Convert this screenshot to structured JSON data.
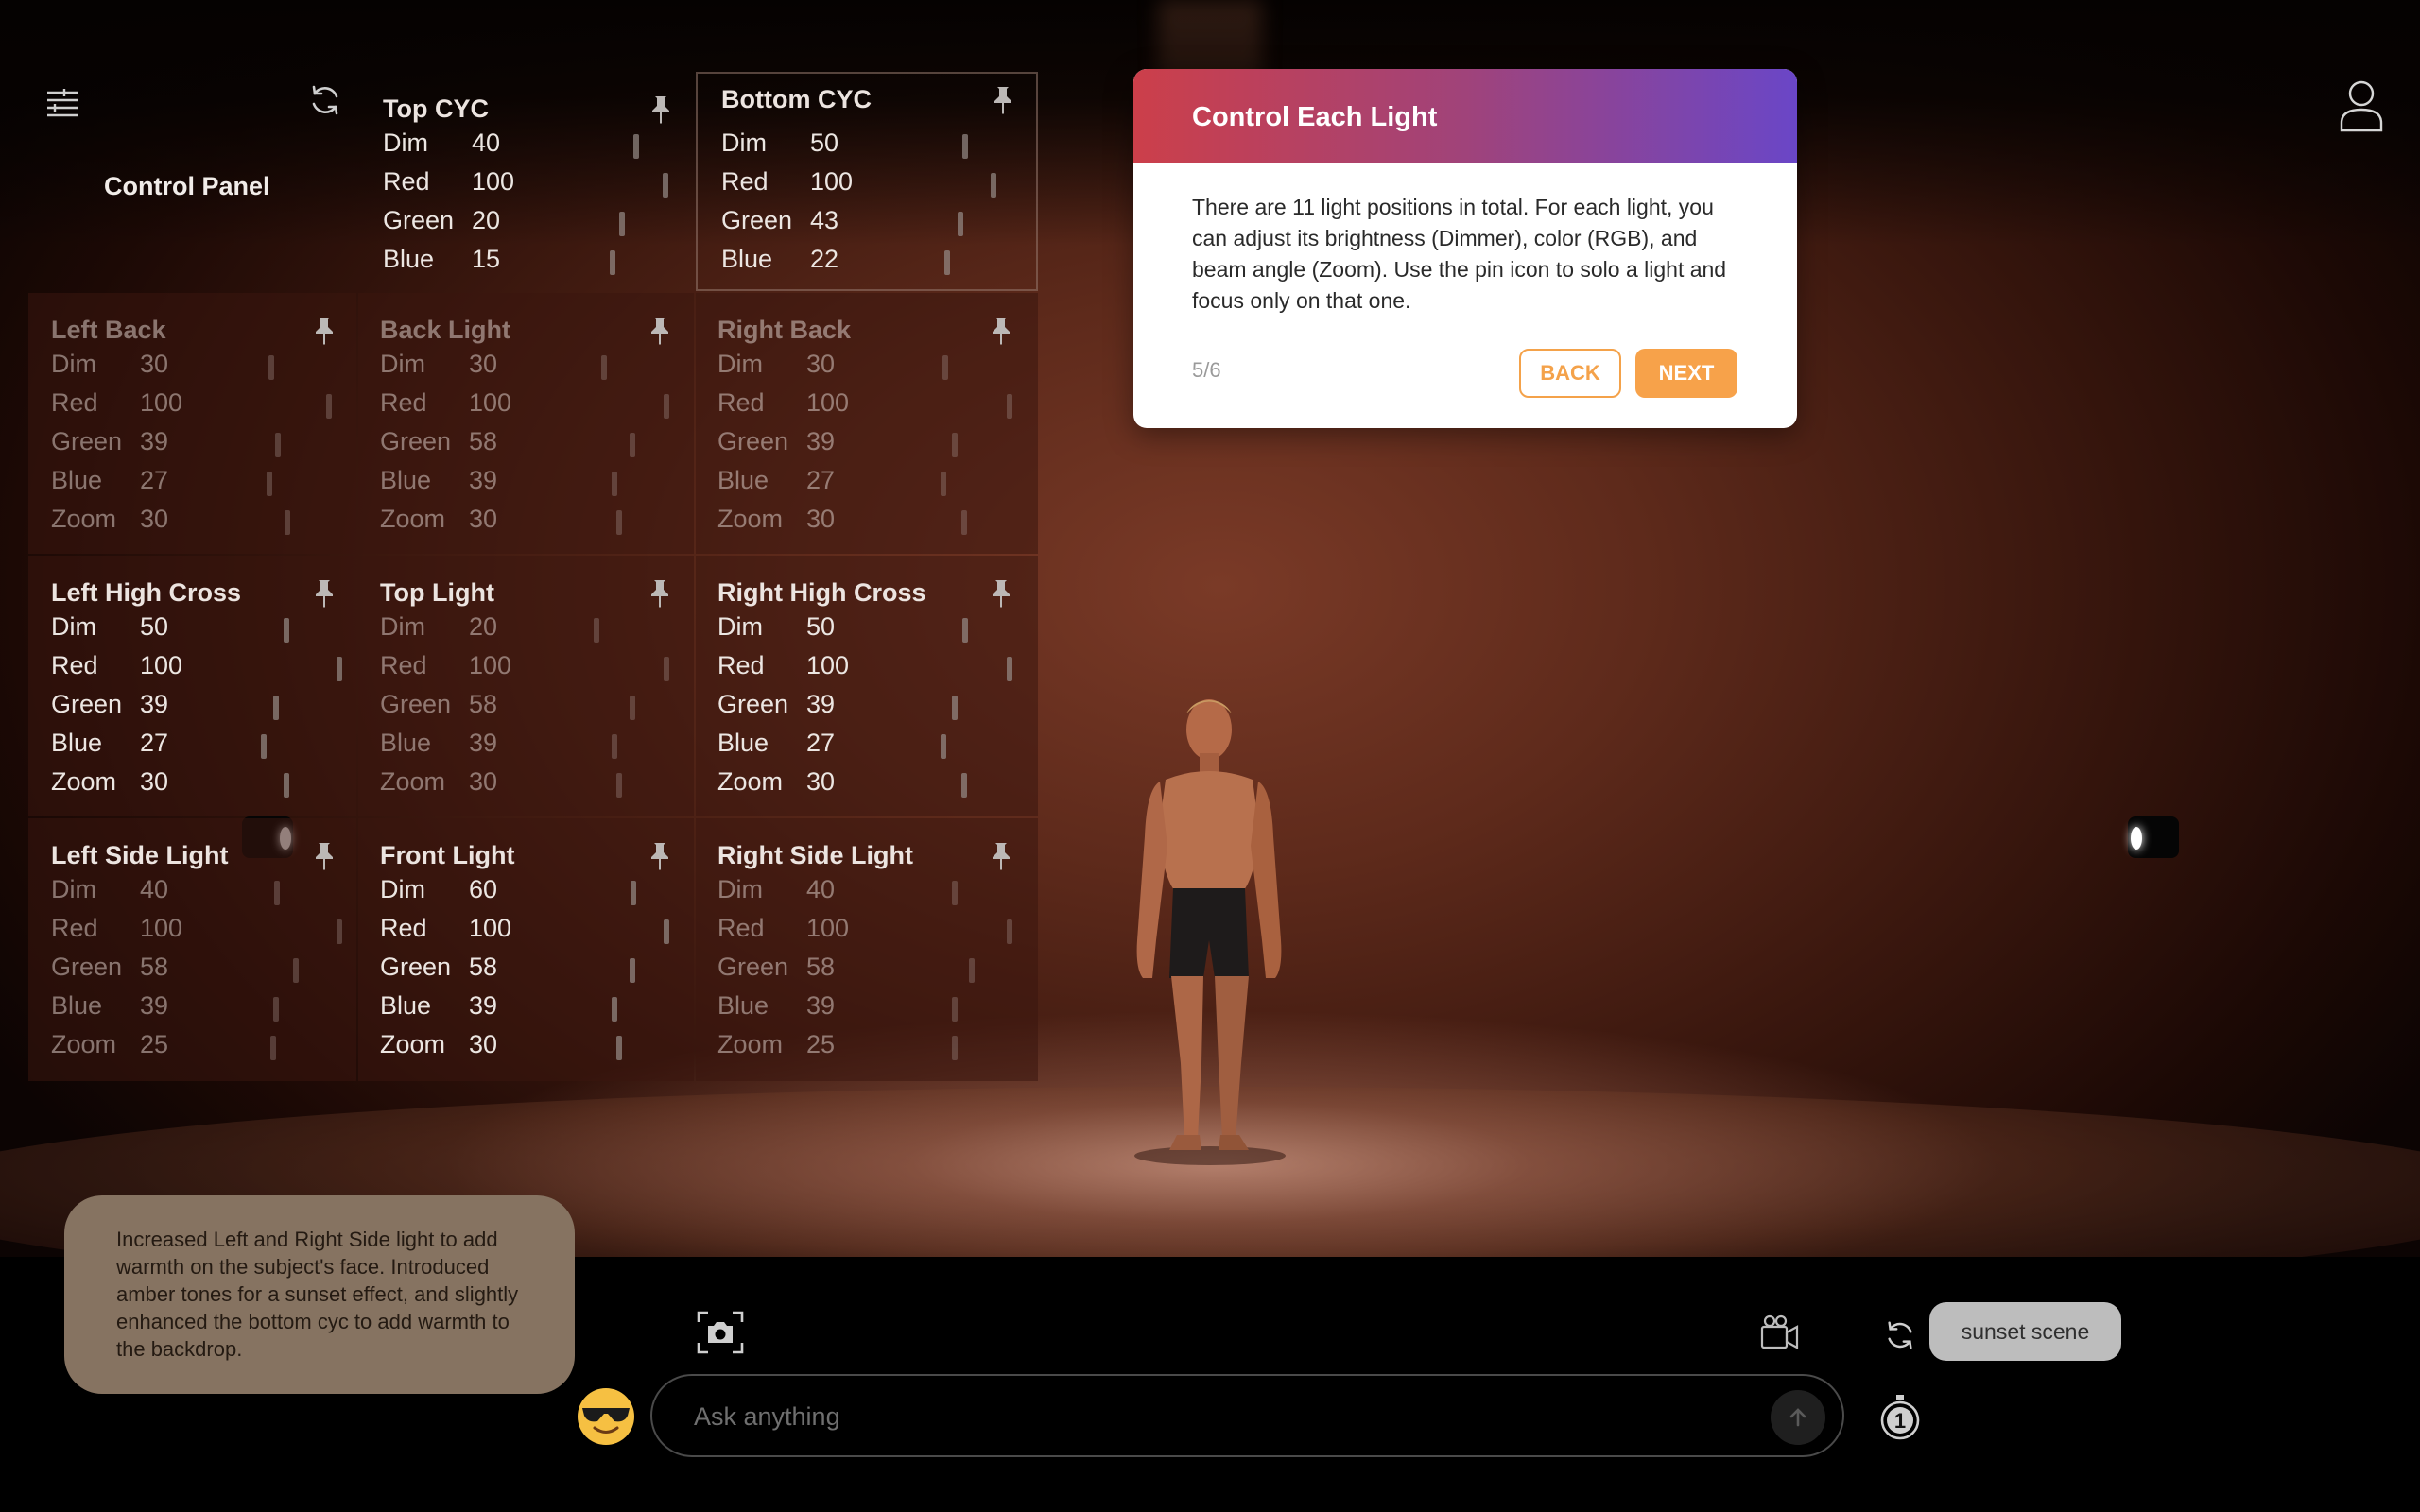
{
  "app": {
    "title": "Control Panel"
  },
  "panels": {
    "top_cyc": {
      "title": "Top CYC",
      "rows": [
        {
          "label": "Dim",
          "value": "40"
        },
        {
          "label": "Red",
          "value": "100"
        },
        {
          "label": "Green",
          "value": "20"
        },
        {
          "label": "Blue",
          "value": "15"
        }
      ]
    },
    "bottom_cyc": {
      "title": "Bottom CYC",
      "rows": [
        {
          "label": "Dim",
          "value": "50"
        },
        {
          "label": "Red",
          "value": "100"
        },
        {
          "label": "Green",
          "value": "43"
        },
        {
          "label": "Blue",
          "value": "22"
        }
      ]
    },
    "left_back": {
      "title": "Left Back",
      "rows": [
        {
          "label": "Dim",
          "value": "30"
        },
        {
          "label": "Red",
          "value": "100"
        },
        {
          "label": "Green",
          "value": "39"
        },
        {
          "label": "Blue",
          "value": "27"
        },
        {
          "label": "Zoom",
          "value": "30"
        }
      ]
    },
    "back_light": {
      "title": "Back Light",
      "rows": [
        {
          "label": "Dim",
          "value": "30"
        },
        {
          "label": "Red",
          "value": "100"
        },
        {
          "label": "Green",
          "value": "58"
        },
        {
          "label": "Blue",
          "value": "39"
        },
        {
          "label": "Zoom",
          "value": "30"
        }
      ]
    },
    "right_back": {
      "title": "Right Back",
      "rows": [
        {
          "label": "Dim",
          "value": "30"
        },
        {
          "label": "Red",
          "value": "100"
        },
        {
          "label": "Green",
          "value": "39"
        },
        {
          "label": "Blue",
          "value": "27"
        },
        {
          "label": "Zoom",
          "value": "30"
        }
      ]
    },
    "left_high_cross": {
      "title": "Left High Cross",
      "rows": [
        {
          "label": "Dim",
          "value": "50"
        },
        {
          "label": "Red",
          "value": "100"
        },
        {
          "label": "Green",
          "value": "39"
        },
        {
          "label": "Blue",
          "value": "27"
        },
        {
          "label": "Zoom",
          "value": "30"
        }
      ]
    },
    "top_light": {
      "title": "Top Light",
      "rows": [
        {
          "label": "Dim",
          "value": "20"
        },
        {
          "label": "Red",
          "value": "100"
        },
        {
          "label": "Green",
          "value": "58"
        },
        {
          "label": "Blue",
          "value": "39"
        },
        {
          "label": "Zoom",
          "value": "30"
        }
      ]
    },
    "right_high_cross": {
      "title": "Right High Cross",
      "rows": [
        {
          "label": "Dim",
          "value": "50"
        },
        {
          "label": "Red",
          "value": "100"
        },
        {
          "label": "Green",
          "value": "39"
        },
        {
          "label": "Blue",
          "value": "27"
        },
        {
          "label": "Zoom",
          "value": "30"
        }
      ]
    },
    "left_side_light": {
      "title": "Left Side Light",
      "rows": [
        {
          "label": "Dim",
          "value": "40"
        },
        {
          "label": "Red",
          "value": "100"
        },
        {
          "label": "Green",
          "value": "58"
        },
        {
          "label": "Blue",
          "value": "39"
        },
        {
          "label": "Zoom",
          "value": "25"
        }
      ]
    },
    "front_light": {
      "title": "Front Light",
      "rows": [
        {
          "label": "Dim",
          "value": "60"
        },
        {
          "label": "Red",
          "value": "100"
        },
        {
          "label": "Green",
          "value": "58"
        },
        {
          "label": "Blue",
          "value": "39"
        },
        {
          "label": "Zoom",
          "value": "30"
        }
      ]
    },
    "right_side_light": {
      "title": "Right Side Light",
      "rows": [
        {
          "label": "Dim",
          "value": "40"
        },
        {
          "label": "Red",
          "value": "100"
        },
        {
          "label": "Green",
          "value": "58"
        },
        {
          "label": "Blue",
          "value": "39"
        },
        {
          "label": "Zoom",
          "value": "25"
        }
      ]
    }
  },
  "tutorial": {
    "title": "Control Each Light",
    "body": "There are 11 light positions in total. For each light, you can adjust its brightness (Dimmer), color (RGB), and beam angle (Zoom). Use the pin icon to solo a light and focus only on that one.",
    "step": "5/6",
    "back_label": "BACK",
    "next_label": "NEXT",
    "gradient_colors": [
      "#cc3f4a",
      "#6a46c7"
    ],
    "accent": "#f7a24a"
  },
  "assistant_note": {
    "text": "Increased Left and Right Side light to add warmth on the subject's face. Introduced amber tones for a sunset effect, and slightly enhanced the bottom cyc to add warmth to the backdrop."
  },
  "chat": {
    "placeholder": "Ask anything",
    "suggestion_chip": "sunset scene",
    "timer_count": "1"
  },
  "icons": [
    "menu-icon",
    "refresh-icon",
    "pin-icon",
    "user-icon",
    "camera-icon",
    "video-camera-icon",
    "emoji-icon",
    "send-icon",
    "timer-icon"
  ]
}
